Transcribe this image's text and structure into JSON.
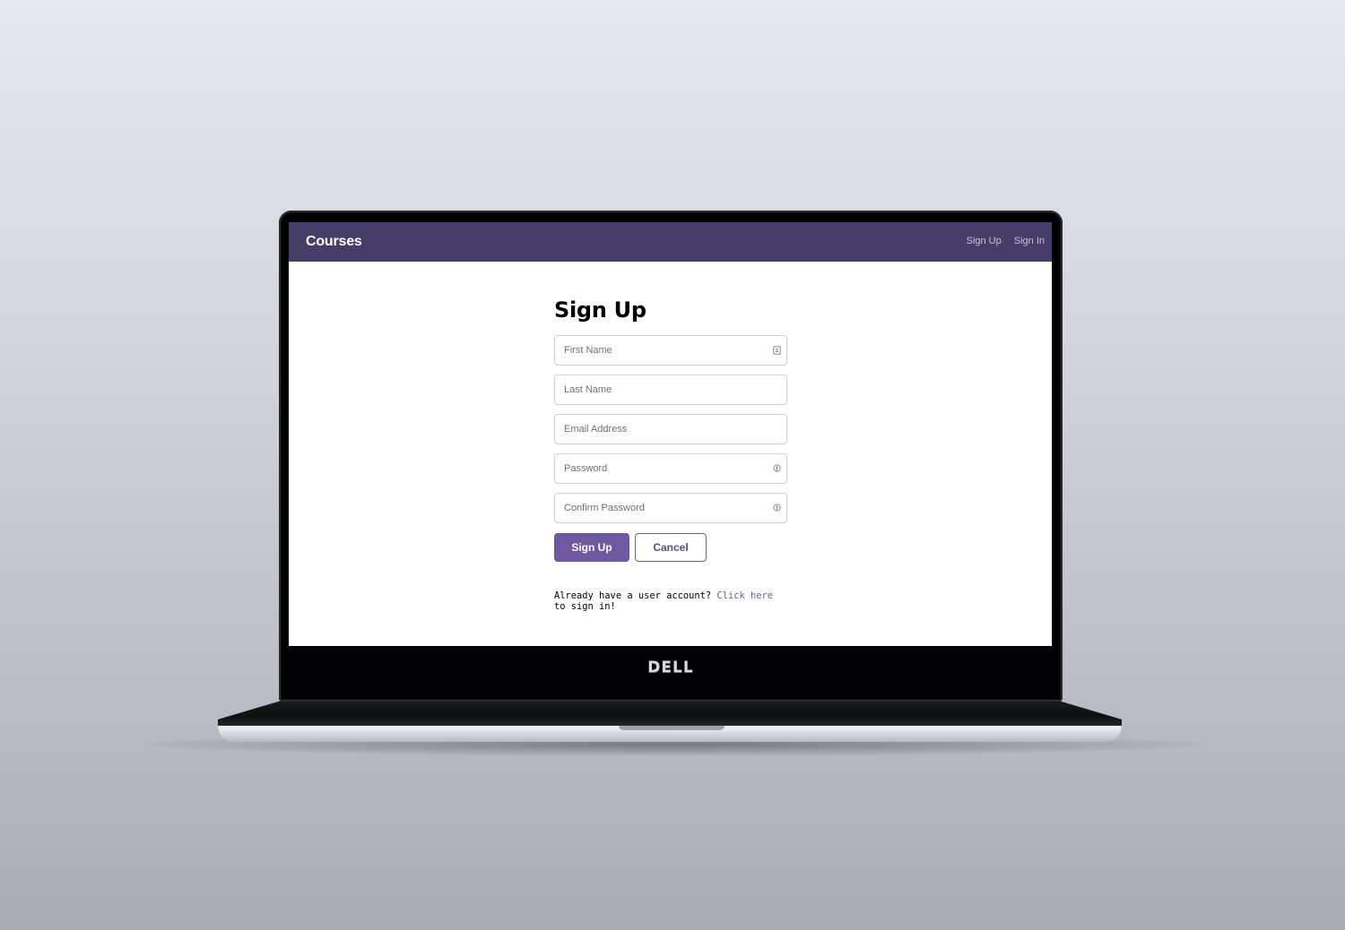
{
  "navbar": {
    "brand": "Courses",
    "links": [
      "Sign Up",
      "Sign In"
    ]
  },
  "form": {
    "title": "Sign Up",
    "fields": [
      {
        "placeholder": "First Name",
        "value": "",
        "icon": "autofill-card-icon"
      },
      {
        "placeholder": "Last Name",
        "value": ""
      },
      {
        "placeholder": "Email Address",
        "value": ""
      },
      {
        "placeholder": "Password",
        "value": "",
        "icon": "password-key-icon"
      },
      {
        "placeholder": "Confirm Password",
        "value": "",
        "icon": "password-key-icon"
      }
    ],
    "submit_label": "Sign Up",
    "cancel_label": "Cancel",
    "footer_prefix": "Already have a user account? ",
    "footer_link": "Click here",
    "footer_suffix": " to sign in!"
  },
  "device": {
    "brand_logo": "DELL"
  },
  "colors": {
    "navbar": "#473d69",
    "accent": "#6e58a0"
  }
}
